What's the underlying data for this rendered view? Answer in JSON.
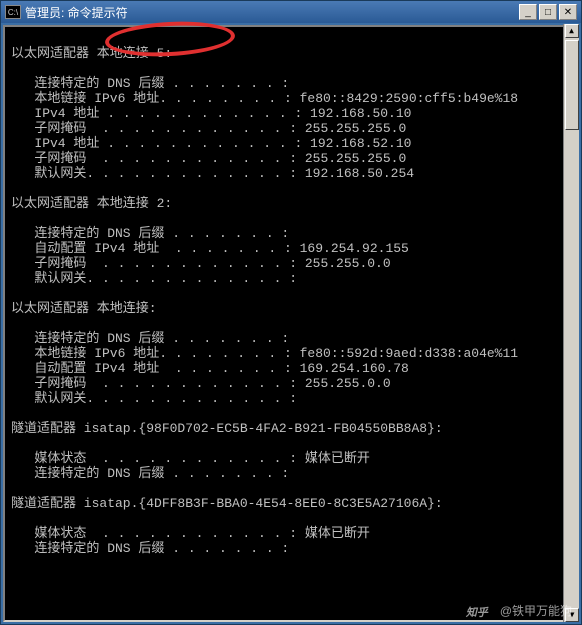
{
  "window": {
    "title": "管理员: 命令提示符",
    "icon_label": "C:\\"
  },
  "annotation": {
    "circled_text": "本地连接 5"
  },
  "adapters": [
    {
      "header": "以太网适配器 本地连接 5:",
      "rows": [
        {
          "label": "   连接特定的 DNS 后缀 . . . . . . . :",
          "value": ""
        },
        {
          "label": "   本地链接 IPv6 地址. . . . . . . . :",
          "value": "fe80::8429:2590:cff5:b49e%18"
        },
        {
          "label": "   IPv4 地址 . . . . . . . . . . . . :",
          "value": "192.168.50.10"
        },
        {
          "label": "   子网掩码  . . . . . . . . . . . . :",
          "value": "255.255.255.0"
        },
        {
          "label": "   IPv4 地址 . . . . . . . . . . . . :",
          "value": "192.168.52.10"
        },
        {
          "label": "   子网掩码  . . . . . . . . . . . . :",
          "value": "255.255.255.0"
        },
        {
          "label": "   默认网关. . . . . . . . . . . . . :",
          "value": "192.168.50.254"
        }
      ]
    },
    {
      "header": "以太网适配器 本地连接 2:",
      "rows": [
        {
          "label": "   连接特定的 DNS 后缀 . . . . . . . :",
          "value": ""
        },
        {
          "label": "   自动配置 IPv4 地址  . . . . . . . :",
          "value": "169.254.92.155"
        },
        {
          "label": "   子网掩码  . . . . . . . . . . . . :",
          "value": "255.255.0.0"
        },
        {
          "label": "   默认网关. . . . . . . . . . . . . :",
          "value": ""
        }
      ]
    },
    {
      "header": "以太网适配器 本地连接:",
      "rows": [
        {
          "label": "   连接特定的 DNS 后缀 . . . . . . . :",
          "value": ""
        },
        {
          "label": "   本地链接 IPv6 地址. . . . . . . . :",
          "value": "fe80::592d:9aed:d338:a04e%11"
        },
        {
          "label": "   自动配置 IPv4 地址  . . . . . . . :",
          "value": "169.254.160.78"
        },
        {
          "label": "   子网掩码  . . . . . . . . . . . . :",
          "value": "255.255.0.0"
        },
        {
          "label": "   默认网关. . . . . . . . . . . . . :",
          "value": ""
        }
      ]
    },
    {
      "header": "隧道适配器 isatap.{98F0D702-EC5B-4FA2-B921-FB04550BB8A8}:",
      "rows": [
        {
          "label": "   媒体状态  . . . . . . . . . . . . :",
          "value": "媒体已断开"
        },
        {
          "label": "   连接特定的 DNS 后缀 . . . . . . . :",
          "value": ""
        }
      ]
    },
    {
      "header": "隧道适配器 isatap.{4DFF8B3F-BBA0-4E54-8EE0-8C3E5A27106A}:",
      "rows": [
        {
          "label": "   媒体状态  . . . . . . . . . . . . :",
          "value": "媒体已断开"
        },
        {
          "label": "   连接特定的 DNS 后缀 . . . . . . . :",
          "value": ""
        }
      ]
    }
  ],
  "watermark": {
    "brand": "知乎",
    "author": "@铁甲万能狗"
  }
}
